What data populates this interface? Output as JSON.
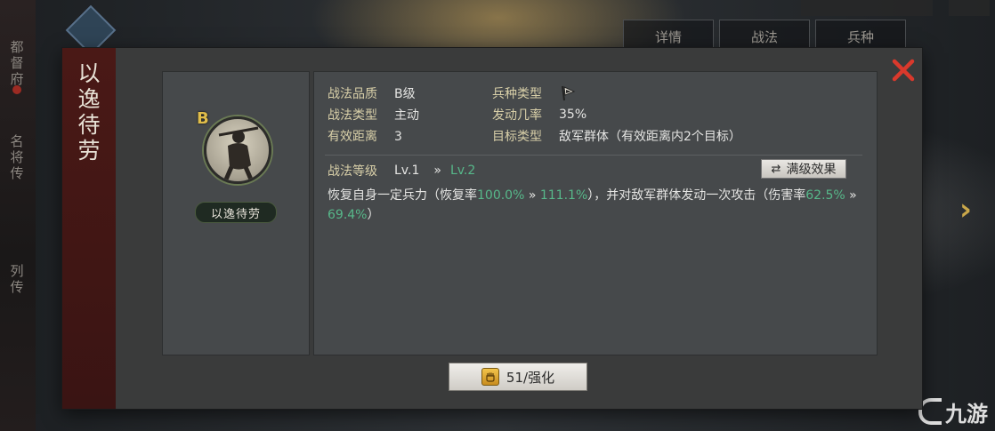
{
  "background": {
    "left_rail_labels": [
      "都督府",
      "名将传",
      "列传"
    ],
    "top_tabs": [
      "详情",
      "战法",
      "兵种"
    ]
  },
  "modal": {
    "title": "以逸待劳",
    "skill": {
      "grade_letter": "B",
      "name_plate": "以逸待劳"
    },
    "info": {
      "quality_label": "战法品质",
      "quality_value": "B级",
      "troop_label": "兵种类型",
      "troop_icon": "cavalry-flag-icon",
      "type_label": "战法类型",
      "type_value": "主动",
      "rate_label": "发动几率",
      "rate_value": "35%",
      "range_label": "有效距离",
      "range_value": "3",
      "target_label": "目标类型",
      "target_value": "敌军群体（有效距离内2个目标）"
    },
    "level": {
      "label": "战法等级",
      "current": "Lv.1",
      "arrow": "»",
      "next": "Lv.2",
      "max_button": "满级效果"
    },
    "description": {
      "p1": "恢复自身一定兵力（恢复率",
      "v1": "100.0%",
      "arrow1": " » ",
      "v2": "111.1%",
      "p2": "），并对敌军群体发动一次攻击（伤害率",
      "v3": "62.5%",
      "arrow2": " » ",
      "v4": "69.4%",
      "p3": "）"
    },
    "enhance_button": "51/强化"
  },
  "colors": {
    "accent_green": "#57b88a",
    "label_gold": "#d8cfa8",
    "close_red": "#d9392c",
    "banner_red": "#4a1916"
  }
}
